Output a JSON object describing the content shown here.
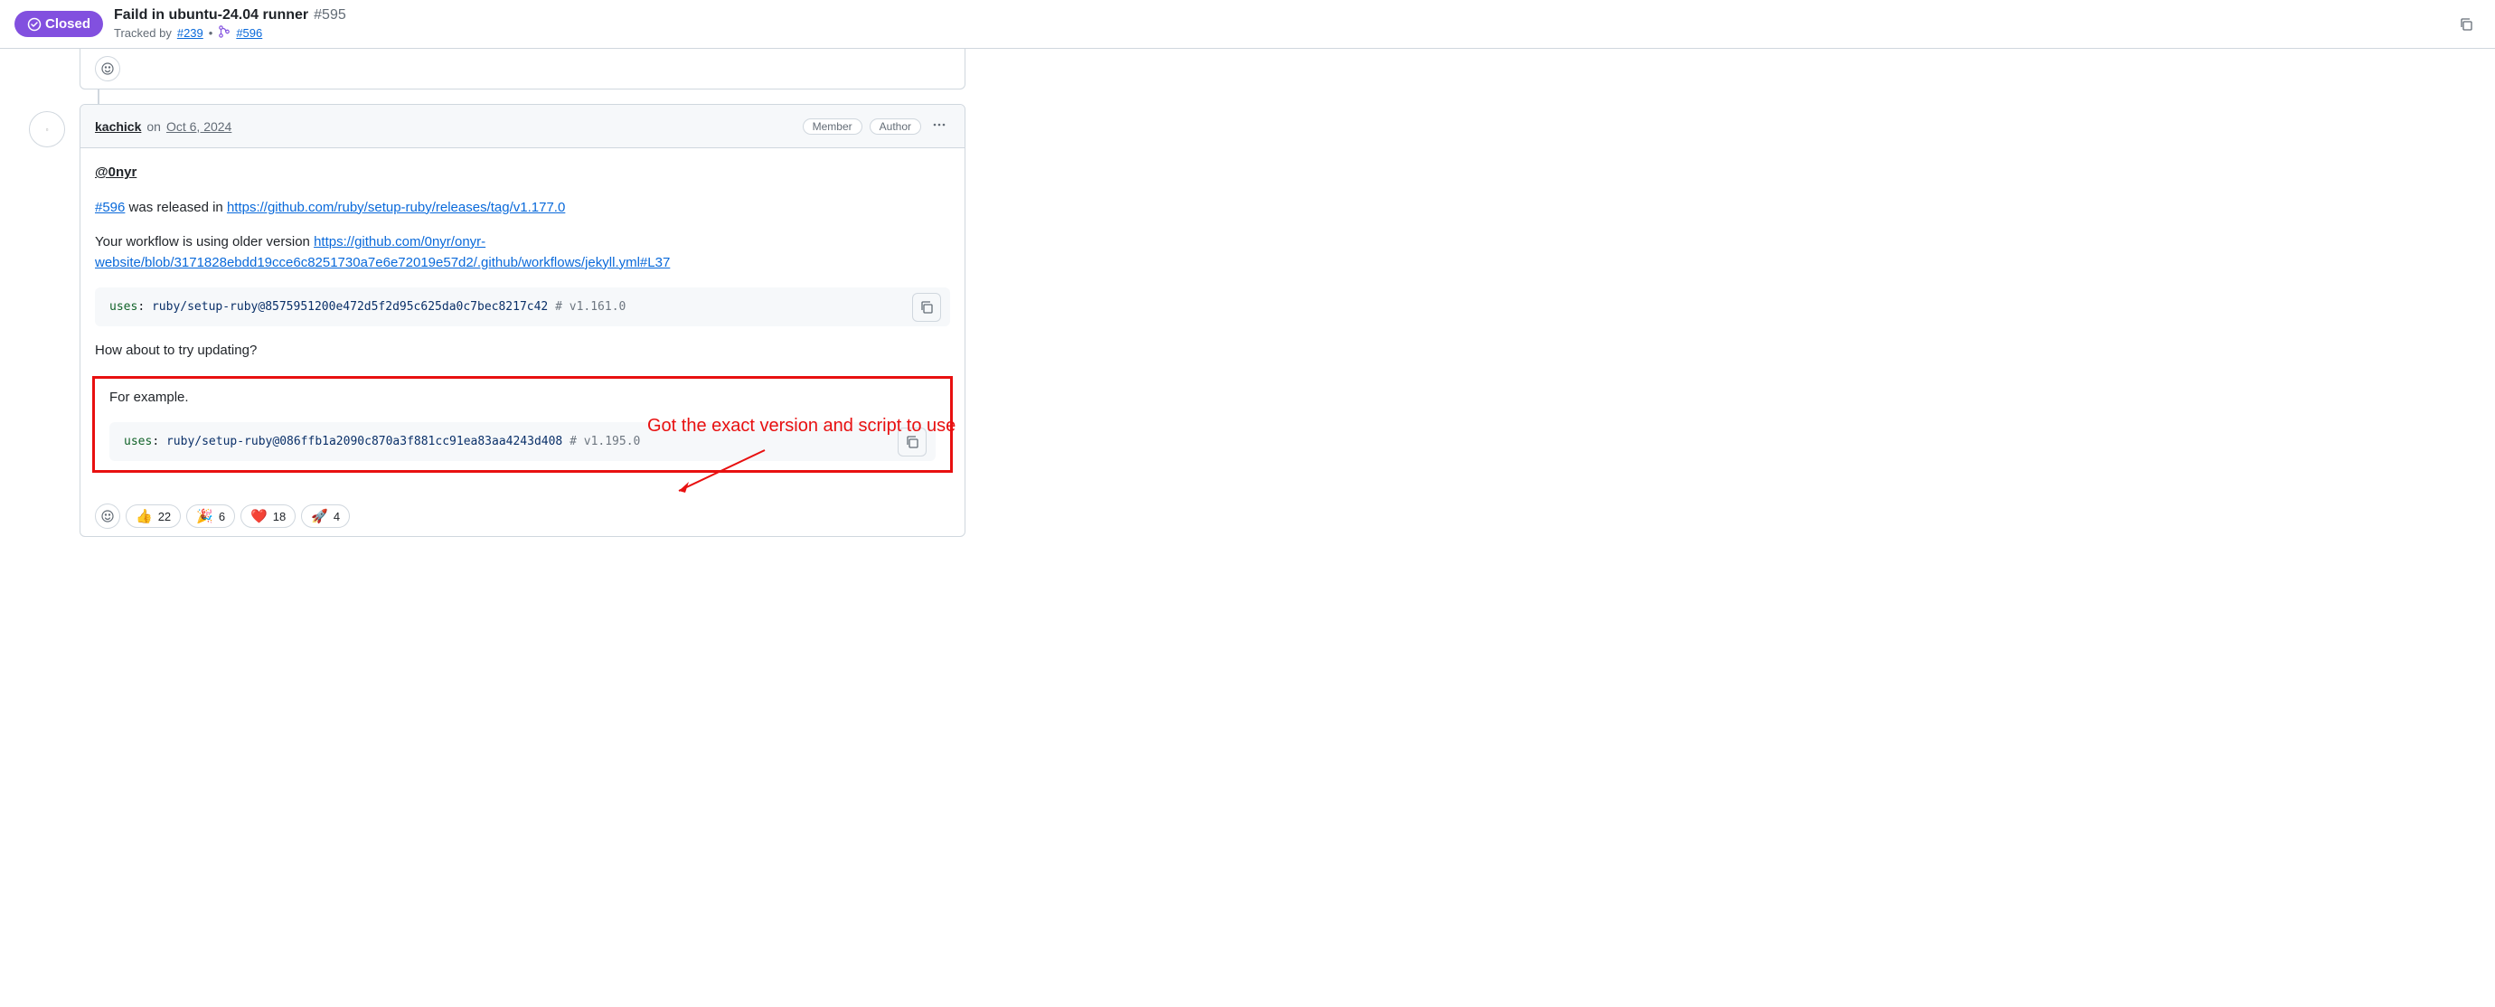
{
  "header": {
    "status": "Closed",
    "title": "Faild in ubuntu-24.04 runner",
    "number": "#595",
    "tracked_by": "Tracked by",
    "tracked_link1": "#239",
    "tracked_link2": "#596"
  },
  "comment": {
    "author": "kachick",
    "date_prefix": "on",
    "date": "Oct 6, 2024",
    "badge_member": "Member",
    "badge_author": "Author",
    "mention": "@0nyr",
    "line1_link": "#596",
    "line1_text": " was released in ",
    "line1_url": "https://github.com/ruby/setup-ruby/releases/tag/v1.177.0",
    "line2_text": "Your workflow is using older version ",
    "line2_url": "https://github.com/0nyr/onyr-website/blob/3171828ebdd19cce6c8251730a7e6e72019e57d2/.github/workflows/jekyll.yml#L37",
    "code1": {
      "key": "uses",
      "value": "ruby/setup-ruby@8575951200e472d5f2d95c625da0c7bec8217c42",
      "comment": "# v1.161.0"
    },
    "line3": "How about to try updating?",
    "line4": "For example.",
    "code2": {
      "key": "uses",
      "value": "ruby/setup-ruby@086ffb1a2090c870a3f881cc91ea83aa4243d408",
      "comment": "# v1.195.0"
    }
  },
  "reactions": {
    "r1": {
      "emoji": "👍",
      "count": "22"
    },
    "r2": {
      "emoji": "🎉",
      "count": "6"
    },
    "r3": {
      "emoji": "❤️",
      "count": "18"
    },
    "r4": {
      "emoji": "🚀",
      "count": "4"
    }
  },
  "annotation": "Got the exact version and script to use"
}
